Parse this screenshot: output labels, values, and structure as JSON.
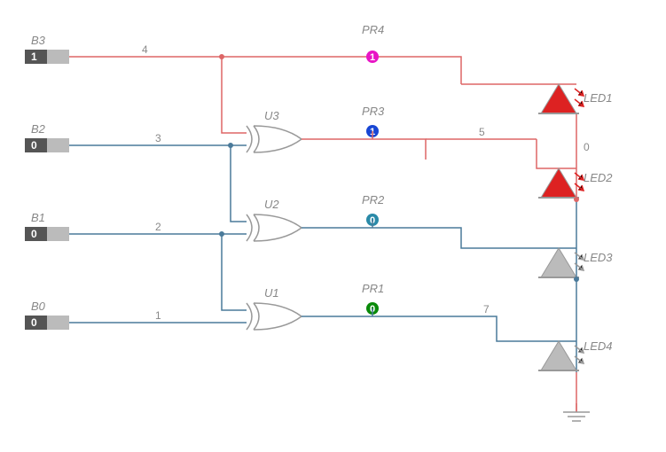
{
  "inputs": {
    "B3": {
      "label": "B3",
      "value": "1",
      "wire": "4",
      "state": "high"
    },
    "B2": {
      "label": "B2",
      "value": "0",
      "wire": "3",
      "state": "low"
    },
    "B1": {
      "label": "B1",
      "value": "0",
      "wire": "2",
      "state": "low"
    },
    "B0": {
      "label": "B0",
      "value": "0",
      "wire": "1",
      "state": "low"
    }
  },
  "gates": {
    "U3": {
      "label": "U3"
    },
    "U2": {
      "label": "U2"
    },
    "U1": {
      "label": "U1"
    }
  },
  "probes": {
    "PR4": {
      "label": "PR4",
      "value": "1",
      "color": "#e815c5"
    },
    "PR3": {
      "label": "PR3",
      "value": "1",
      "color": "#1846d4"
    },
    "PR2": {
      "label": "PR2",
      "value": "0",
      "color": "#2a8aa8"
    },
    "PR1": {
      "label": "PR1",
      "value": "0",
      "color": "#0a8a0a"
    }
  },
  "leds": {
    "LED1": {
      "label": "LED1",
      "on": true
    },
    "LED2": {
      "label": "LED2",
      "on": true
    },
    "LED3": {
      "label": "LED3",
      "on": false
    },
    "LED4": {
      "label": "LED4",
      "on": false
    }
  },
  "wires": {
    "u3out": "5",
    "busright": "0",
    "u1out": "7"
  }
}
